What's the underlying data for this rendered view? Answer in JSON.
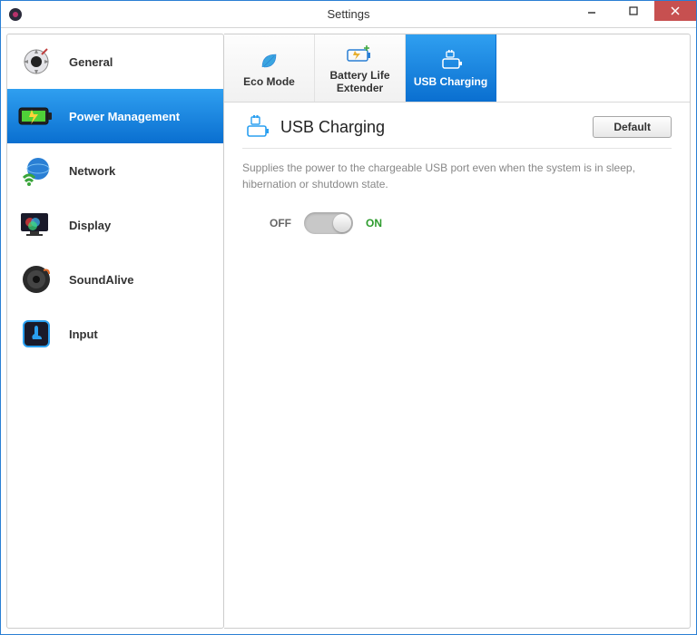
{
  "window": {
    "title": "Settings"
  },
  "sidebar": {
    "items": [
      {
        "label": "General"
      },
      {
        "label": "Power Management"
      },
      {
        "label": "Network"
      },
      {
        "label": "Display"
      },
      {
        "label": "SoundAlive"
      },
      {
        "label": "Input"
      }
    ],
    "active_index": 1
  },
  "tabs": {
    "items": [
      {
        "label": "Eco Mode"
      },
      {
        "label": "Battery Life Extender"
      },
      {
        "label": "USB Charging"
      }
    ],
    "active_index": 2
  },
  "panel": {
    "title": "USB Charging",
    "default_button": "Default",
    "description": "Supplies the power to the chargeable USB port even when the system is in sleep, hibernation or shutdown state.",
    "toggle": {
      "off_label": "OFF",
      "on_label": "ON",
      "state": "on"
    }
  }
}
